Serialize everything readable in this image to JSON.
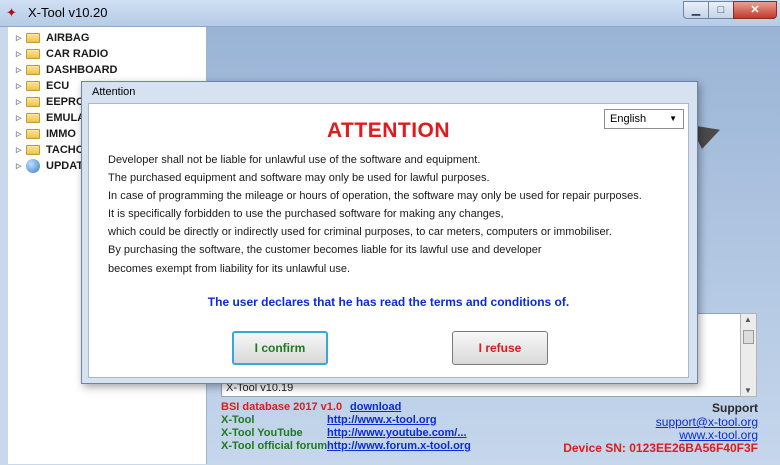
{
  "window": {
    "title": "X-Tool v10.20",
    "min_glyph": "▁",
    "max_glyph": "□",
    "close_glyph": "✕"
  },
  "tree": {
    "items": [
      {
        "label": "AIRBAG",
        "icon": "folder-icon"
      },
      {
        "label": "CAR RADIO",
        "icon": "folder-icon"
      },
      {
        "label": "DASHBOARD",
        "icon": "folder-icon"
      },
      {
        "label": "ECU",
        "icon": "folder-icon"
      },
      {
        "label": "EEPRO",
        "icon": "folder-icon"
      },
      {
        "label": "EMULA",
        "icon": "folder-icon"
      },
      {
        "label": "IMMO",
        "icon": "folder-icon"
      },
      {
        "label": "TACHO",
        "icon": "folder-icon"
      },
      {
        "label": "UPDAT",
        "icon": "globe-icon"
      }
    ]
  },
  "log": {
    "last_line": "X-Tool v10.19"
  },
  "footer": {
    "bsi_label": "BSI database 2017 v1.0",
    "bsi_link": "download",
    "links": [
      {
        "label": "X-Tool",
        "url": "http://www.x-tool.org"
      },
      {
        "label": "X-Tool YouTube",
        "url": "http://www.youtube.com/..."
      },
      {
        "label": "X-Tool official forum",
        "url": "http://www.forum.x-tool.org"
      }
    ],
    "support_title": "Support",
    "support_email": "support@x-tool.org",
    "support_site": "www.x-tool.org",
    "device_sn": "Device SN: 0123EE26BA56F40F3F"
  },
  "dialog": {
    "title": "Attention",
    "language": "English",
    "heading": "ATTENTION",
    "lines": [
      "Developer shall not be liable for unlawful use of the software and equipment.",
      "The purchased equipment and software may only be used for lawful purposes.",
      "In case of programming the mileage or hours of operation, the software may only be used for repair purposes.",
      "It is specifically forbidden to use the purchased software for making any changes,",
      "which could be directly or indirectly used for criminal purposes, to car meters, computers or immobiliser.",
      "By purchasing the software, the customer becomes liable for its lawful use and developer",
      "becomes exempt from liability for its unlawful use."
    ],
    "declaration": "The user declares that he has read the terms and conditions of.",
    "confirm_label": "I confirm",
    "refuse_label": "I refuse"
  },
  "colors": {
    "danger": "#e01b1b",
    "accept": "#1d7a1d",
    "link": "#0b2bd6"
  }
}
